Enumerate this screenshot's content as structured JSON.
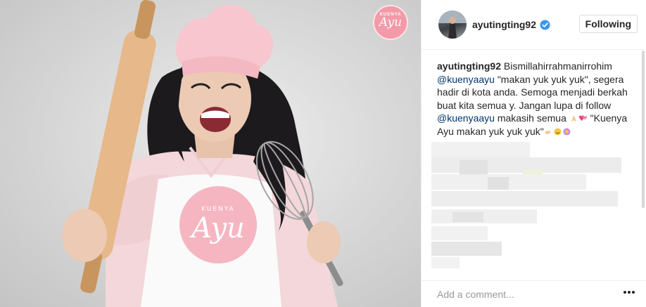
{
  "post": {
    "username": "ayutingting92",
    "follow_button": "Following",
    "caption": {
      "username": "ayutingting92",
      "text_1": " Bismillahirrahmanirrohim ",
      "mention_1": "@kuenyaayu",
      "text_2": " \"makan yuk yuk yuk\", segera hadir di kota anda. Semoga menjadi berkah buat kita semua y. Jangan lupa di follow ",
      "mention_2": "@kuenyaayu",
      "text_3": " makasih semua ",
      "text_4": " \"Kuenya Ayu makan yuk yuk yuk\""
    },
    "comment_placeholder": "Add a comment...",
    "photo_logo": {
      "top": "KUENYA",
      "main": "Ayu"
    },
    "apron_logo": {
      "top": "KUENYA",
      "main": "Ayu"
    }
  },
  "icons": {
    "verified": "verified-badge-icon",
    "more": "more-options-icon"
  },
  "colors": {
    "verified_blue": "#3897f0",
    "link": "#003569",
    "brand_pink": "#f29aa8"
  }
}
